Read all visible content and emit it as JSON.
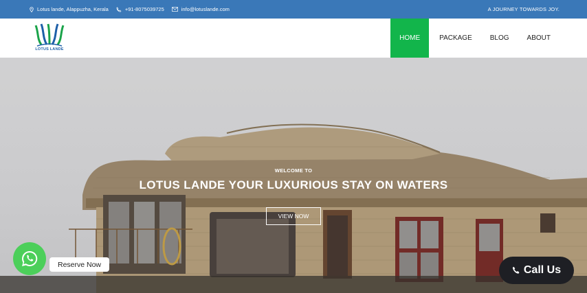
{
  "topbar": {
    "address": "Lotus lande, Alappuzha, Kerala",
    "phone": "+91-8075039725",
    "email": "info@lotuslande.com",
    "tagline": "A JOURNEY TOWARDS JOY."
  },
  "header": {
    "logo_text": "LOTUS LANDE"
  },
  "nav": {
    "items": [
      {
        "label": "HOME",
        "active": true
      },
      {
        "label": "PACKAGE",
        "active": false
      },
      {
        "label": "BLOG",
        "active": false
      },
      {
        "label": "ABOUT",
        "active": false
      }
    ]
  },
  "hero": {
    "welcome": "WELCOME TO",
    "headline": "LOTUS LANDE YOUR LUXURIOUS STAY ON WATERS",
    "button_label": "VIEW NOW"
  },
  "floating": {
    "reserve_label": "Reserve Now",
    "call_label": "Call Us"
  },
  "colors": {
    "topbar": "#3a78b8",
    "nav_active": "#12b54b",
    "whatsapp": "#4ccf5a",
    "call_button": "#1e1f24"
  }
}
